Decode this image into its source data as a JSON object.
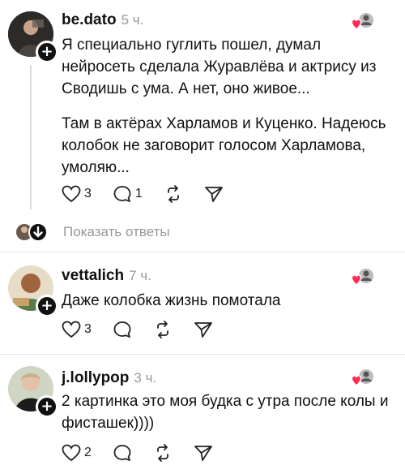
{
  "comments": [
    {
      "username": "be.dato",
      "time": "5 ч.",
      "paragraphs": [
        "Я специально гуглить пошел, думал нейросеть сделала Журавлёва и актрису из Сводишь с ума. А нет, оно живое...",
        "Там в актёрах Харламов и Куценко. Надеюсь колобок не заговорит голосом Харламова, умоляю..."
      ],
      "likes": "3",
      "replies": "1"
    },
    {
      "username": "vettalich",
      "time": "7 ч.",
      "paragraphs": [
        "Даже колобка жизнь помотала"
      ],
      "likes": "3",
      "replies": ""
    },
    {
      "username": "j.lollypop",
      "time": "3 ч.",
      "paragraphs": [
        "2 картинка это моя будка с утра после колы и фисташек))))"
      ],
      "likes": "2",
      "replies": ""
    }
  ],
  "show_replies_label": "Показать ответы",
  "icons": {
    "like": "heart-outline-icon",
    "reply": "comment-bubble-icon",
    "repost": "repost-icon",
    "share": "send-icon",
    "follow": "plus-icon",
    "liked_by_author": "heart-badge-icon"
  },
  "colors": {
    "heart": "#ff2d55",
    "muted": "#999999",
    "text": "#111111"
  }
}
